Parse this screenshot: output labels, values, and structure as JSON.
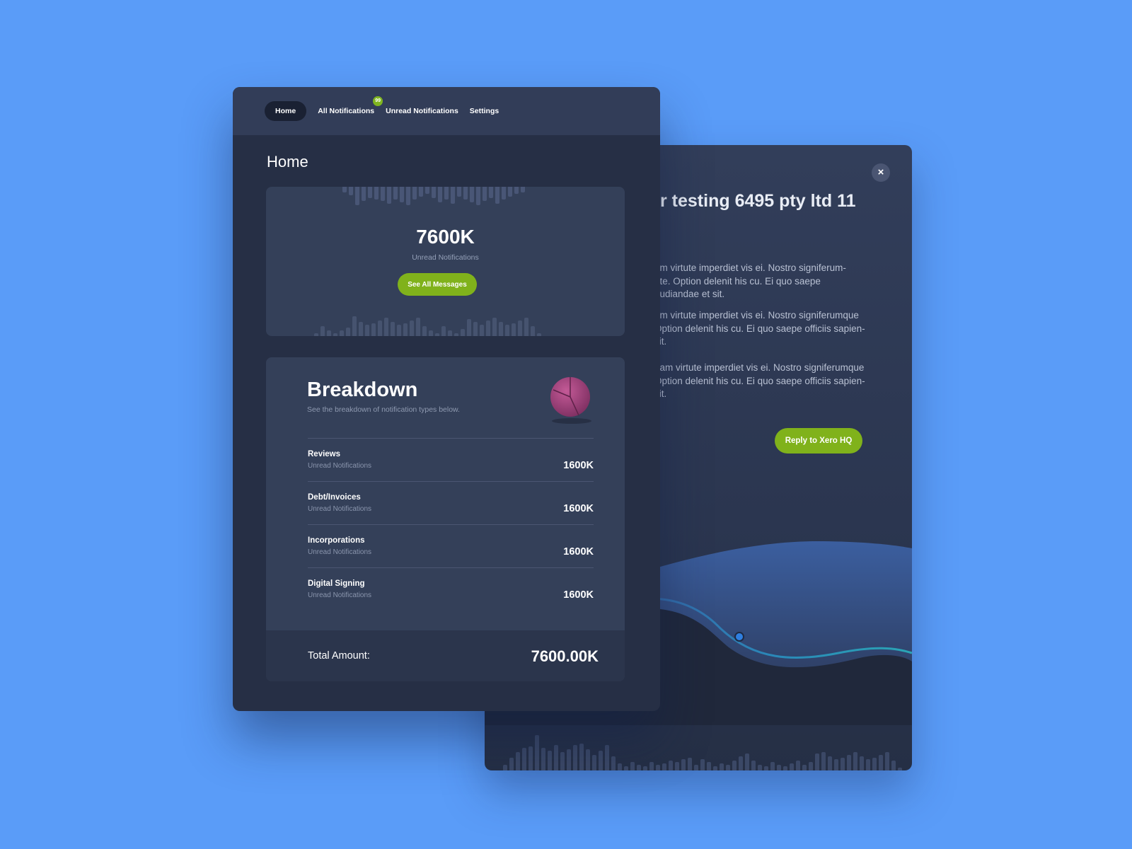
{
  "detail": {
    "close_label": "×",
    "title": "r testing 6495 pty ltd 11",
    "paragraphs": [
      [
        "am virtute imperdiet vis ei. Nostro signiferum-",
        "t te. Option delenit his cu. Ei quo saepe",
        "pudiandae et sit."
      ],
      [
        "am virtute imperdiet vis ei. Nostro signiferumque",
        "Option delenit his cu. Ei quo saepe officiis sapien-",
        "sit."
      ],
      [
        "gam virtute imperdiet vis ei. Nostro signiferumque",
        "Option delenit his cu. Ei quo saepe officiis sapien-",
        "sit."
      ]
    ],
    "reply_label": "Reply to Xero HQ"
  },
  "nav": {
    "tabs": [
      {
        "label": "Home",
        "active": true
      },
      {
        "label": "All Notifications",
        "badge": "99"
      },
      {
        "label": "Unread Notifications"
      },
      {
        "label": "Settings"
      }
    ]
  },
  "page_title": "Home",
  "summary": {
    "count": "7600K",
    "count_label": "Unread Notifications",
    "button_label": "See All Messages"
  },
  "breakdown": {
    "title": "Breakdown",
    "description": "See the breakdown of notification types below.",
    "rows": [
      {
        "name": "Reviews",
        "sub": "Unread Notifications",
        "value": "1600K"
      },
      {
        "name": "Debt/Invoices",
        "sub": "Unread Notifications",
        "value": "1600K"
      },
      {
        "name": "Incorporations",
        "sub": "Unread Notifications",
        "value": "1600K"
      },
      {
        "name": "Digital Signing",
        "sub": "Unread Notifications",
        "value": "1600K"
      }
    ],
    "total_label": "Total Amount:",
    "total_value": "7600.00K"
  },
  "colors": {
    "background": "#5a9cf8",
    "accent_green": "#80b21b",
    "card_dark": "#262f45",
    "pie_magenta": "#a8457f"
  }
}
